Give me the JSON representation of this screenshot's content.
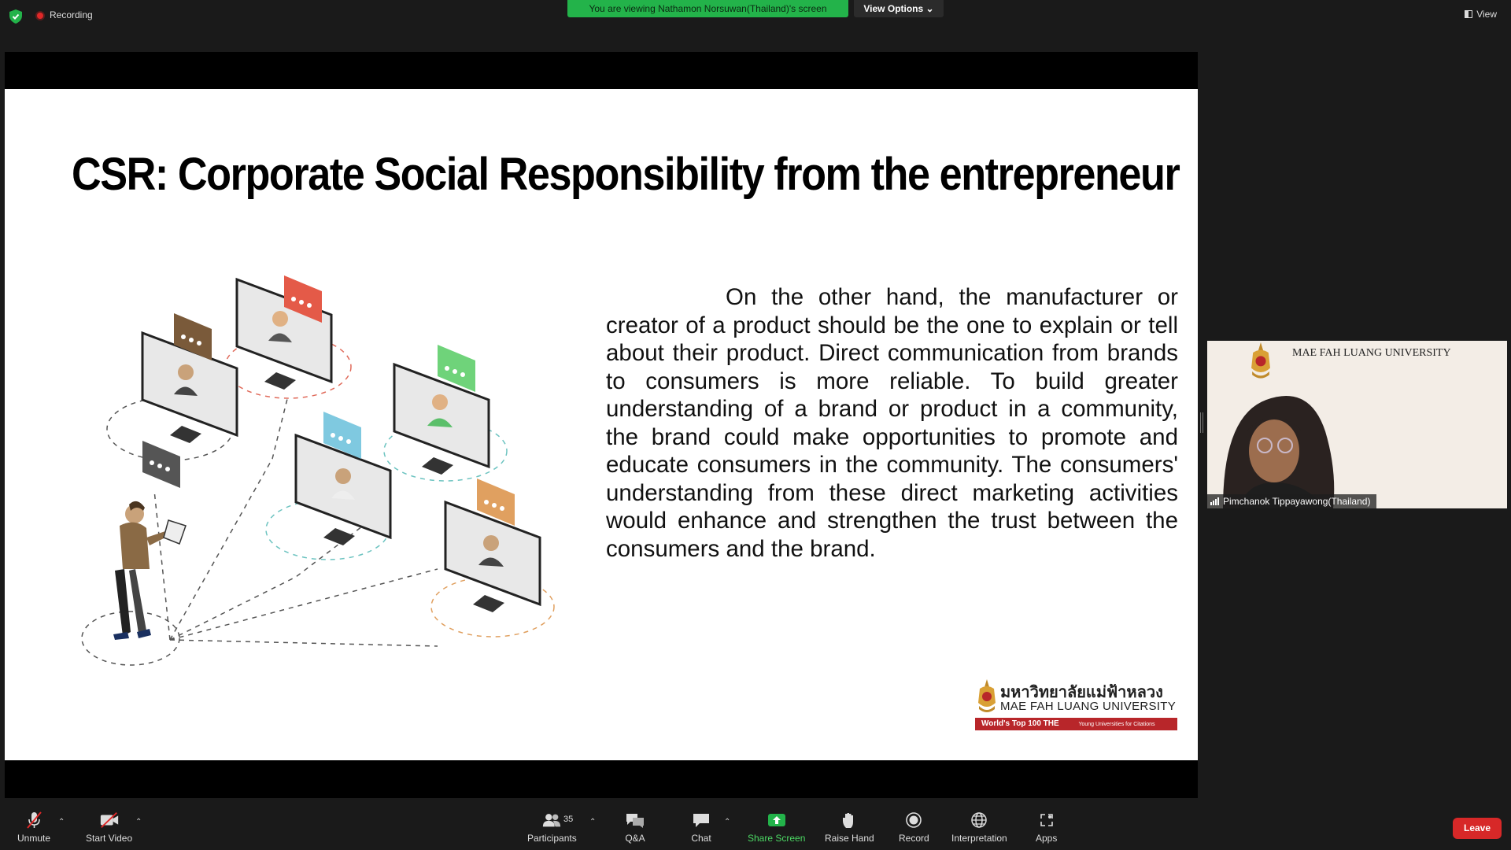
{
  "topbar": {
    "recording_label": "Recording",
    "viewing_banner": "You are viewing Nathamon Norsuwan(Thailand)'s screen",
    "view_options_label": "View Options",
    "view_label": "View"
  },
  "slide": {
    "title": "CSR: Corporate Social Responsibility from the entrepreneur",
    "body": "On the other hand, the manufacturer or creator of a product should be the one to explain or tell about their product. Direct communication from brands to consumers is more reliable. To build greater understanding of a brand or product in a community, the brand could make opportunities to promote and educate consumers in the community. The consumers' understanding from these direct marketing activities would enhance and strengthen the trust between the consumers and the brand.",
    "logo": {
      "thai": "มหาวิทยาลัยแม่ฟ้าหลวง",
      "english": "MAE FAH LUANG UNIVERSITY",
      "ranking": "World's Top 100 THE",
      "ranking_sub": "Young Universities for Citations"
    }
  },
  "video_tile": {
    "university": "MAE FAH LUANG UNIVERSITY",
    "participant_name": "Pimchanok Tippayawong(Thailand)"
  },
  "toolbar": {
    "unmute": "Unmute",
    "start_video": "Start Video",
    "participants": "Participants",
    "participants_count": "35",
    "qa": "Q&A",
    "chat": "Chat",
    "share_screen": "Share Screen",
    "raise_hand": "Raise Hand",
    "record": "Record",
    "interpretation": "Interpretation",
    "apps": "Apps",
    "leave": "Leave"
  },
  "colors": {
    "banner_green": "#23b34a",
    "leave_red": "#d72828",
    "share_green": "#23b34a",
    "logo_red": "#b8262a"
  }
}
